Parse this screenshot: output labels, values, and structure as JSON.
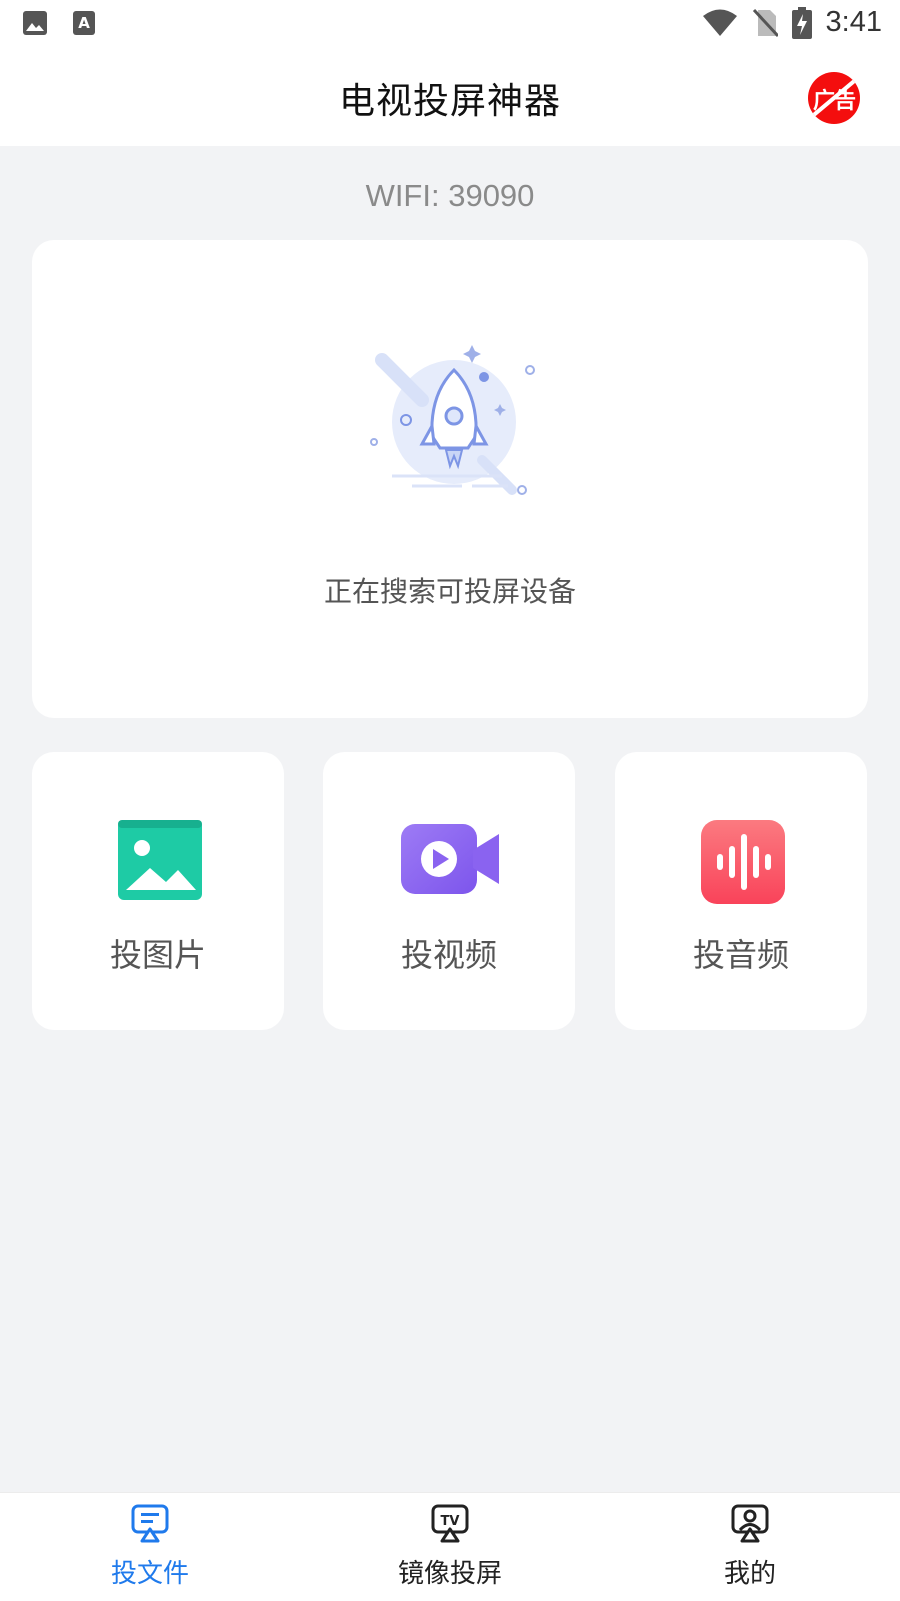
{
  "status_bar": {
    "time": "3:41",
    "icons": [
      "image-icon",
      "text-a-icon",
      "wifi-icon",
      "no-sim-icon",
      "battery-charging-icon"
    ]
  },
  "header": {
    "title": "电视投屏神器",
    "ad_badge": "广告"
  },
  "wifi": {
    "label": "WIFI: 39090"
  },
  "search_card": {
    "icon": "rocket-icon",
    "status_text": "正在搜索可投屏设备"
  },
  "features": [
    {
      "label": "投图片",
      "icon": "image-icon",
      "color": "#1ecba5"
    },
    {
      "label": "投视频",
      "icon": "video-icon",
      "color": "#8a63f0"
    },
    {
      "label": "投音频",
      "icon": "audio-wave-icon",
      "color": "#fb5f6d"
    }
  ],
  "bottom_nav": {
    "items": [
      {
        "label": "投文件",
        "icon": "cast-file-icon",
        "active": true
      },
      {
        "label": "镜像投屏",
        "icon": "tv-cast-icon",
        "active": false
      },
      {
        "label": "我的",
        "icon": "profile-cast-icon",
        "active": false
      }
    ]
  },
  "colors": {
    "accent": "#1f7aec",
    "background": "#f2f3f5",
    "ad_badge": "#f40e0e"
  }
}
